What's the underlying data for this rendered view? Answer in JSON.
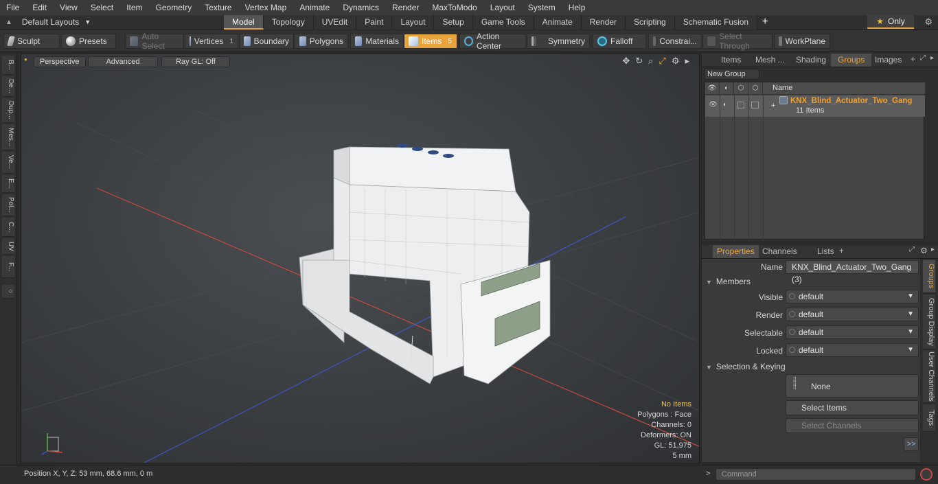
{
  "menu": [
    "File",
    "Edit",
    "View",
    "Select",
    "Item",
    "Geometry",
    "Texture",
    "Vertex Map",
    "Animate",
    "Dynamics",
    "Render",
    "MaxToModo",
    "Layout",
    "System",
    "Help"
  ],
  "layout": {
    "name": "Default Layouts",
    "only_label": "Only"
  },
  "tabs": [
    "Model",
    "Topology",
    "UVEdit",
    "Paint",
    "Layout",
    "Setup",
    "Game Tools",
    "Animate",
    "Render",
    "Scripting",
    "Schematic Fusion"
  ],
  "toolbar": {
    "sculpt": "Sculpt",
    "presets": "Presets",
    "auto_select": "Auto Select",
    "vertices": "Vertices",
    "vertices_count": "1",
    "boundary": "Boundary",
    "polygons": "Polygons",
    "materials": "Materials",
    "items": "Items",
    "items_count": "5",
    "action_center": "Action Center",
    "symmetry": "Symmetry",
    "falloff": "Falloff",
    "constraints": "Constrai...",
    "select_through": "Select Through",
    "workplane": "WorkPlane"
  },
  "left_tabs": [
    "B...",
    "De...",
    "Dup...",
    "Mes...",
    "Ve...",
    "E...",
    "Pol...",
    "C...",
    "UV",
    "F..."
  ],
  "viewport": {
    "view": "Perspective",
    "shading": "Advanced",
    "raygl": "Ray GL: Off",
    "stats": {
      "selection": "No Items",
      "polygons": "Polygons : Face",
      "channels": "Channels: 0",
      "deformers": "Deformers: ON",
      "gl": "GL: 51,975",
      "unit": "5 mm"
    }
  },
  "status": {
    "position": "Position X, Y, Z:   53 mm, 68.6 mm, 0 m"
  },
  "right_tabs": [
    "Items",
    "Mesh ...",
    "Shading",
    "Groups",
    "Images"
  ],
  "groups": {
    "new_group": "New Group",
    "name_col": "Name",
    "group_name": "KNX_Blind_Actuator_Two_Gang",
    "group_count": "11 Items"
  },
  "prop_tabs": [
    "Properties",
    "Channels",
    "Lists"
  ],
  "properties": {
    "name_label": "Name",
    "name_value": "KNX_Blind_Actuator_Two_Gang (3)",
    "members": "Members",
    "visible_label": "Visible",
    "visible_value": "default",
    "render_label": "Render",
    "render_value": "default",
    "selectable_label": "Selectable",
    "selectable_value": "default",
    "locked_label": "Locked",
    "locked_value": "default",
    "selection_keying": "Selection & Keying",
    "none_label": "None",
    "select_items": "Select Items",
    "select_channels": "Select Channels"
  },
  "right_vtabs": [
    "Groups",
    "Group Display",
    "User Channels",
    "Tags"
  ],
  "command": {
    "placeholder": "Command"
  },
  "colors": {
    "accent": "#e8a33a",
    "group_name": "#f0a030"
  }
}
